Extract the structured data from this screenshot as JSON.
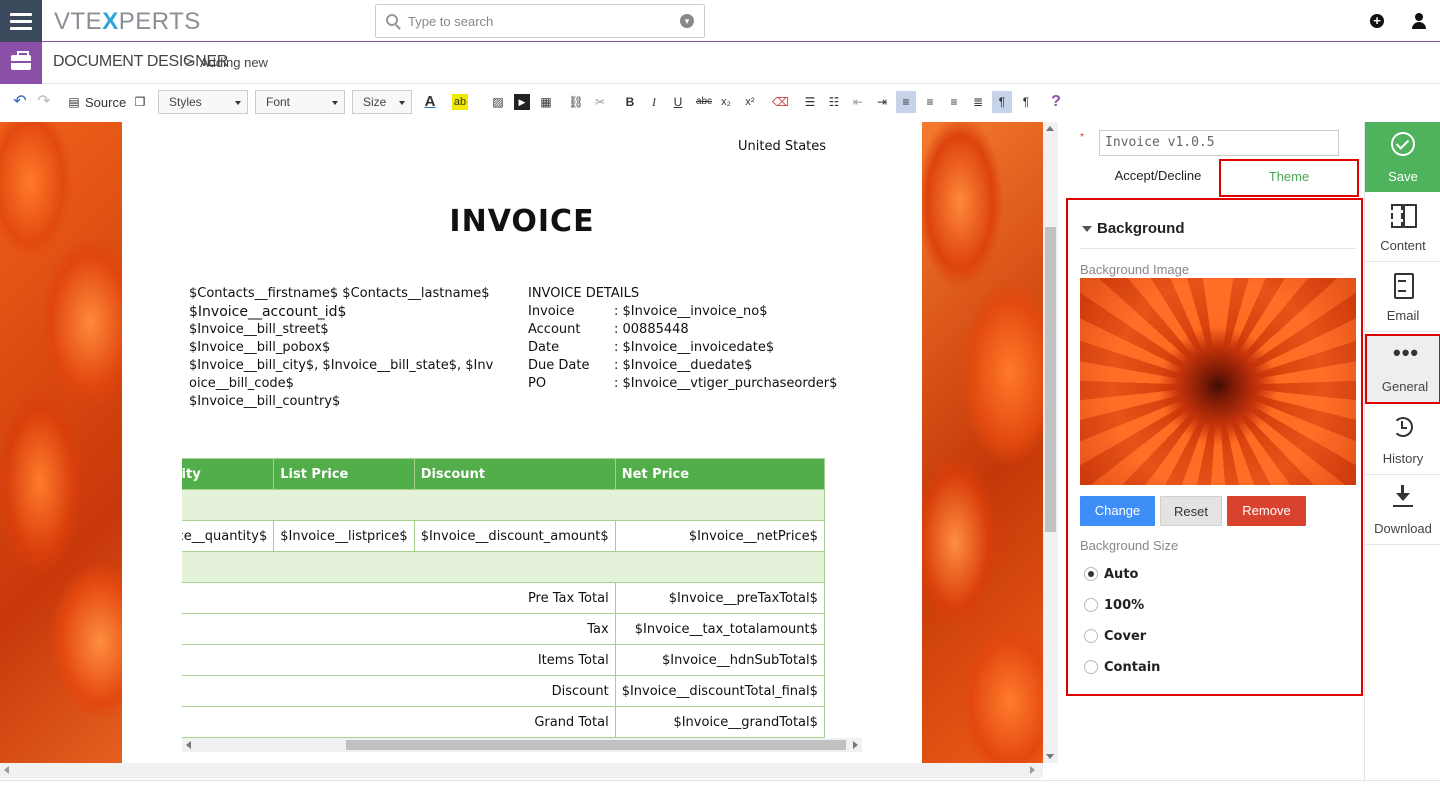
{
  "app": {
    "logo_text_a": "VTE",
    "logo_text_b": "X",
    "logo_text_c": "PERTS"
  },
  "search": {
    "placeholder": "Type to search"
  },
  "breadcrumb": {
    "module": "DOCUMENT DESIGNER",
    "separator": ">",
    "page": "Adding new"
  },
  "toolbar": {
    "source_label": "Source",
    "styles_label": "Styles",
    "font_label": "Font",
    "size_label": "Size",
    "bold": "B",
    "italic": "I",
    "underline": "U",
    "strike": "abc",
    "subscript": "x₂",
    "superscript": "x²",
    "help": "?"
  },
  "document": {
    "country": "United States",
    "title": "INVOICE",
    "address_lines": [
      "$Contacts__firstname$ $Contacts__lastname$",
      "$Invoice__account_id$",
      "$Invoice__bill_street$",
      "$Invoice__bill_pobox$",
      "$Invoice__bill_city$, $Invoice__bill_state$, $Inv",
      "oice__bill_code$",
      "$Invoice__bill_country$"
    ],
    "details_header": "INVOICE DETAILS",
    "details": [
      {
        "key": "Invoice",
        "value": ": $Invoice__invoice_no$"
      },
      {
        "key": "Account",
        "value": ": 00885448"
      },
      {
        "key": "Date",
        "value": ": $Invoice__invoicedate$"
      },
      {
        "key": "Due Date",
        "value": ": $Invoice__duedate$"
      },
      {
        "key": "PO",
        "value": ": $Invoice__vtiger_purchaseorder$"
      }
    ],
    "table": {
      "headers": [
        "Quantity",
        "List Price",
        "Discount",
        "Net Price"
      ],
      "item_row": [
        "$Invoice__quantity$",
        "$Invoice__listprice$",
        "$Invoice__discount_amount$",
        "$Invoice__netPrice$"
      ],
      "totals": [
        {
          "label": "Pre Tax Total",
          "value": "$Invoice__preTaxTotal$"
        },
        {
          "label": "Tax",
          "value": "$Invoice__tax_totalamount$"
        },
        {
          "label": "Items Total",
          "value": "$Invoice__hdnSubTotal$"
        },
        {
          "label": "Discount",
          "value": "$Invoice__discountTotal_final$"
        },
        {
          "label": "Grand Total",
          "value": "$Invoice__grandTotal$"
        }
      ]
    }
  },
  "panel": {
    "template_name": "Invoice v1.0.5",
    "required_mark": "*",
    "tabs": [
      {
        "label": "Accept/Decline"
      },
      {
        "label": "Theme"
      }
    ],
    "section_title": "Background",
    "bg_image_label": "Background Image",
    "buttons": {
      "change": "Change",
      "reset": "Reset",
      "remove": "Remove"
    },
    "bg_size_label": "Background Size",
    "size_options": [
      {
        "label": "Auto",
        "selected": true
      },
      {
        "label": "100%",
        "selected": false
      },
      {
        "label": "Cover",
        "selected": false
      },
      {
        "label": "Contain",
        "selected": false
      }
    ]
  },
  "sidebar": {
    "items": [
      {
        "label": "Save",
        "icon": "check-circle-icon"
      },
      {
        "label": "Content",
        "icon": "content-icon"
      },
      {
        "label": "Email",
        "icon": "email-doc-icon"
      },
      {
        "label": "General",
        "icon": "ellipsis-icon"
      },
      {
        "label": "History",
        "icon": "history-icon"
      },
      {
        "label": "Download",
        "icon": "download-icon"
      }
    ]
  },
  "colors": {
    "accent_purple": "#8b4fa8",
    "table_green": "#52ad4b",
    "save_green": "#4fb35d",
    "highlight_red": "#e00000",
    "change_blue": "#3e8ef7",
    "remove_red": "#d9422f"
  }
}
